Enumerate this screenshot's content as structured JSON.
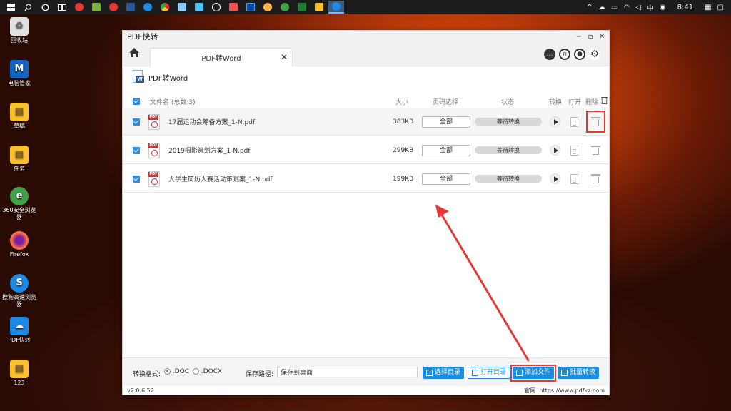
{
  "taskbar": {
    "ime": "中",
    "time": "8:41"
  },
  "desktop": {
    "icons": [
      {
        "label": "回收站"
      },
      {
        "label": "电脑管家"
      },
      {
        "label": "草稿"
      },
      {
        "label": "任务"
      },
      {
        "label": "360安全浏览器"
      },
      {
        "label": "Firefox"
      },
      {
        "label": "搜狗高速浏览器"
      },
      {
        "label": "PDF快转"
      },
      {
        "label": "123"
      }
    ]
  },
  "window": {
    "title": "PDF快转",
    "tab_label": "PDF转Word",
    "tab_close": "✕",
    "section_title": "PDF转Word",
    "logo_letter": "W"
  },
  "list": {
    "header": {
      "filename": "文件名 (总数:3)",
      "size": "大小",
      "page_select": "页码选择",
      "status": "状态",
      "convert": "转换",
      "open": "打开",
      "delete": "删除"
    },
    "rows": [
      {
        "name": "17届运动会筹备方案_1-N.pdf",
        "size": "383KB",
        "pages": "全部",
        "status": "等待转换"
      },
      {
        "name": "2019摄影策划方案_1-N.pdf",
        "size": "299KB",
        "pages": "全部",
        "status": "等待转换"
      },
      {
        "name": "大学生简历大赛活动策划案_1-N.pdf",
        "size": "199KB",
        "pages": "全部",
        "status": "等待转换"
      }
    ]
  },
  "bottom": {
    "format_label": "转换格式:",
    "format_doc": ".DOC",
    "format_docx": ".DOCX",
    "save_label": "保存路径:",
    "save_value": "保存到桌面",
    "btn_choose_dir": "选择目录",
    "btn_open_dir": "打开目录",
    "btn_add_file": "添加文件",
    "btn_batch": "批量转换"
  },
  "status": {
    "version": "v2.0.6.52",
    "site": "官网: https://www.pdfkz.com"
  },
  "colors": {
    "accent": "#1a8fe0",
    "highlight": "#e53935"
  }
}
